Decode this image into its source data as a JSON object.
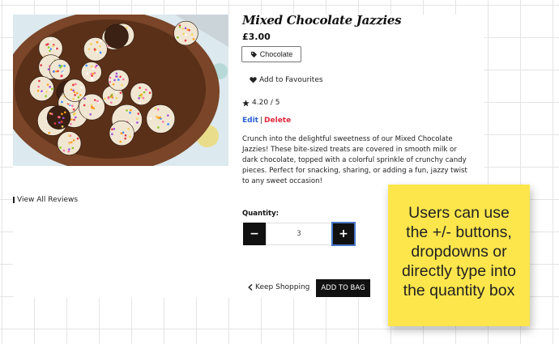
{
  "product": {
    "title": "Mixed Chocolate Jazzies",
    "price": "£3.00",
    "category_tag": "Chocolate",
    "favourite_label": "Add to Favourites",
    "rating": "4.20 / 5",
    "edit_label": "Edit",
    "delete_label": "Delete",
    "separator": "|",
    "description": "Crunch into the delightful sweetness of our Mixed Chocolate Jazzies! These bite-sized treats are covered in smooth milk or dark chocolate, topped with a colorful sprinkle of crunchy candy pieces. Perfect for snacking, sharing, or adding a fun, jazzy twist to any sweet occasion!",
    "reviews_link": "View All Reviews"
  },
  "quantity": {
    "label": "Quantity:",
    "value": "3",
    "minus_label": "−",
    "plus_label": "+"
  },
  "actions": {
    "keep_shopping": "Keep Shopping",
    "add_to_bag": "ADD TO BAG"
  },
  "sticky_note": {
    "text": "Users can use the +/- buttons, dropdowns or directly type into the quantity box"
  },
  "icons": {
    "tag": "tag-icon",
    "heart": "heart-icon",
    "star": "star-icon",
    "chevron": "chevron-left-icon",
    "reviews": "vertical-bar-icon"
  },
  "colors": {
    "sticky_note": "#fde64b",
    "edit_link": "#2a5fd6",
    "delete_link": "#e0283c",
    "buttons": "#111111",
    "plus_focus_outline": "#4a78c8"
  }
}
